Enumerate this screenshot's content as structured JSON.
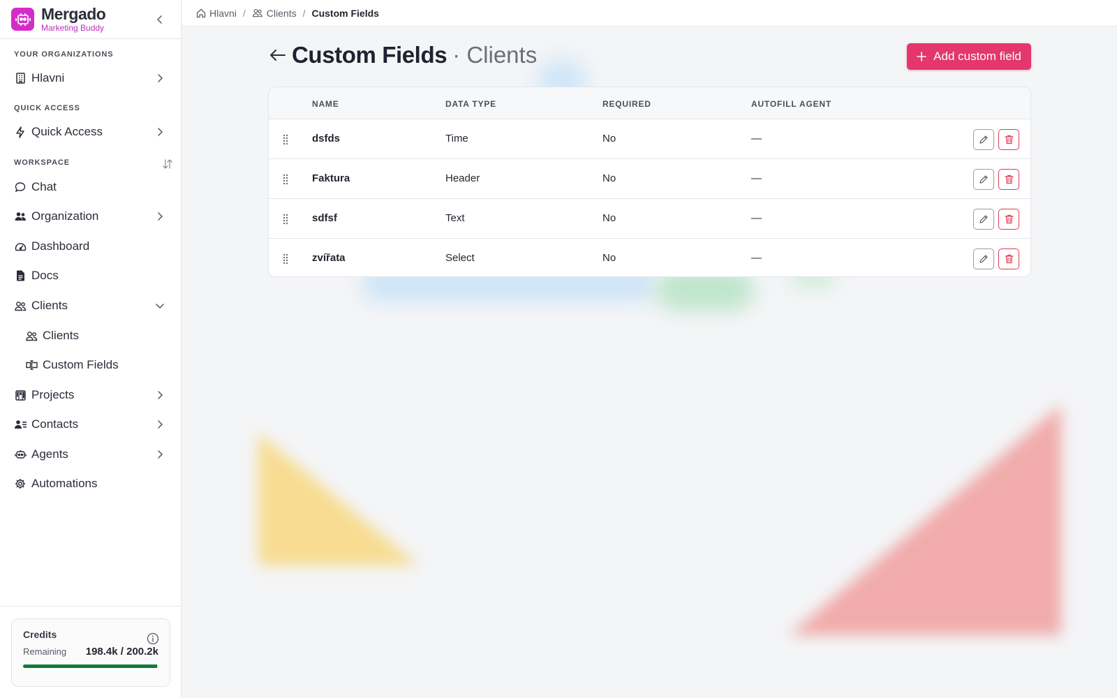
{
  "brand": {
    "name": "Mergado",
    "subtitle": "Marketing Buddy"
  },
  "sidebar": {
    "sections": {
      "organizations": "YOUR ORGANIZATIONS",
      "quick_access": "QUICK ACCESS",
      "workspace": "WORKSPACE"
    },
    "items": {
      "hlavni": "Hlavni",
      "quick_access": "Quick Access",
      "chat": "Chat",
      "organization": "Organization",
      "dashboard": "Dashboard",
      "docs": "Docs",
      "clients": "Clients",
      "clients_sub": "Clients",
      "custom_fields_sub": "Custom Fields",
      "projects": "Projects",
      "contacts": "Contacts",
      "agents": "Agents",
      "automations": "Automations"
    }
  },
  "credits": {
    "title": "Credits",
    "label": "Remaining",
    "value": "198.4k / 200.2k",
    "fraction": 0.991
  },
  "breadcrumb": {
    "home": "Hlavni",
    "clients": "Clients",
    "current": "Custom Fields"
  },
  "page": {
    "title": "Custom Fields",
    "subtitle": "· Clients",
    "add_button": "Add custom field"
  },
  "table": {
    "headers": {
      "name": "NAME",
      "data_type": "DATA TYPE",
      "required": "REQUIRED",
      "autofill": "AUTOFILL AGENT"
    },
    "rows": [
      {
        "name": "dsfds",
        "type": "Time",
        "required": "No",
        "autofill": "—"
      },
      {
        "name": "Faktura",
        "type": "Header",
        "required": "No",
        "autofill": "—"
      },
      {
        "name": "sdfsf",
        "type": "Text",
        "required": "No",
        "autofill": "—"
      },
      {
        "name": "zvířata",
        "type": "Select",
        "required": "No",
        "autofill": "—"
      }
    ]
  },
  "colors": {
    "accent": "#e3376e",
    "brand": "#d42cc9",
    "credits_bar": "#127a3a",
    "delete": "#e03a55"
  }
}
